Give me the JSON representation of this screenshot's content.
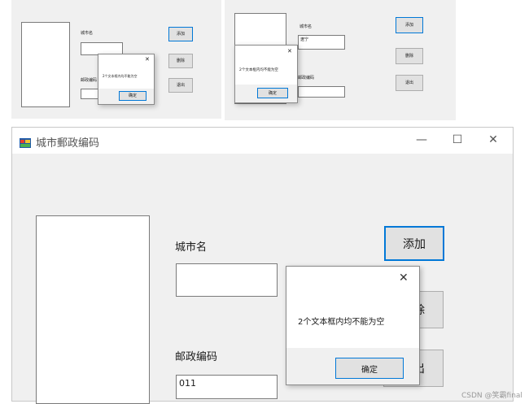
{
  "window": {
    "title": "城市郵政编码",
    "minimize_glyph": "—",
    "maximize_glyph": "☐",
    "close_glyph": "✕",
    "icon": "form-app-icon"
  },
  "form": {
    "city_label": "城市名",
    "city_value": "",
    "postal_label": "邮政编码",
    "postal_value": "011",
    "add_label": "添加",
    "delete_label": "删除",
    "exit_label": "退出"
  },
  "dialog": {
    "message": "2个文本框内均不能为空",
    "ok_label": "确定",
    "close_glyph": "✕"
  },
  "thumb_left": {
    "city_label": "城市名",
    "city_value": "",
    "postal_label": "邮政编码",
    "postal_value": "",
    "add_label": "添加",
    "delete_label": "删除",
    "exit_label": "退出",
    "message": "2个文本框内均不能为空",
    "ok_label": "确定",
    "close_glyph": "✕"
  },
  "thumb_right": {
    "city_label": "城市名",
    "city_value": "遼宁",
    "postal_label": "邮政编码",
    "postal_value": "",
    "add_label": "添加",
    "delete_label": "删除",
    "exit_label": "退出",
    "message": "2个文本框内均不能为空",
    "ok_label": "确定",
    "close_glyph": "✕"
  },
  "watermark": "CSDN @笑霸final",
  "colors": {
    "form_background": "#f0f0f0",
    "accent_border": "#0078d7",
    "button_face": "#e1e1e1"
  }
}
